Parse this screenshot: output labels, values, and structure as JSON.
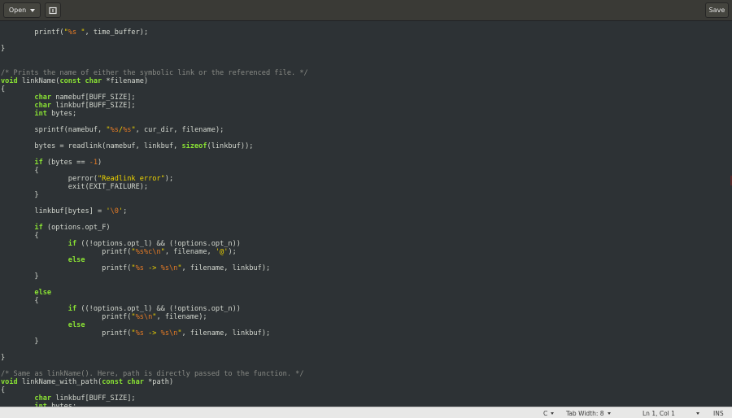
{
  "header": {
    "open_label": "Open",
    "new_tab_icon": "new-document-icon",
    "save_label": "Save"
  },
  "editor": {
    "language": "C",
    "lines": [
      [
        [
          "",
          "        printf("
        ],
        [
          "str",
          "\""
        ],
        [
          "esc",
          "%s"
        ],
        [
          "str",
          " \""
        ],
        [
          "",
          ", time_buffer);"
        ]
      ],
      [],
      [
        [
          "",
          "}"
        ]
      ],
      [],
      [],
      [
        [
          "cmt",
          "/* Prints the name of either the symbolic link or the referenced file. */"
        ]
      ],
      [
        [
          "kw",
          "void"
        ],
        [
          "",
          " linkName("
        ],
        [
          "kw",
          "const char"
        ],
        [
          "",
          " *filename)"
        ]
      ],
      [
        [
          "",
          "{"
        ]
      ],
      [
        [
          "",
          "        "
        ],
        [
          "kw",
          "char"
        ],
        [
          "",
          " namebuf[BUFF_SIZE];"
        ]
      ],
      [
        [
          "",
          "        "
        ],
        [
          "kw",
          "char"
        ],
        [
          "",
          " linkbuf[BUFF_SIZE];"
        ]
      ],
      [
        [
          "",
          "        "
        ],
        [
          "kw",
          "int"
        ],
        [
          "",
          " bytes;"
        ]
      ],
      [],
      [
        [
          "",
          "        sprintf(namebuf, "
        ],
        [
          "str",
          "\""
        ],
        [
          "esc",
          "%s"
        ],
        [
          "str",
          "/"
        ],
        [
          "esc",
          "%s"
        ],
        [
          "str",
          "\""
        ],
        [
          "",
          ", cur_dir, filename);"
        ]
      ],
      [],
      [
        [
          "",
          "        bytes = readlink(namebuf, linkbuf, "
        ],
        [
          "kw",
          "sizeof"
        ],
        [
          "",
          "(linkbuf));"
        ]
      ],
      [],
      [
        [
          "",
          "        "
        ],
        [
          "kw",
          "if"
        ],
        [
          "",
          " (bytes == "
        ],
        [
          "esc",
          "-1"
        ],
        [
          "",
          ")"
        ]
      ],
      [
        [
          "",
          "        {"
        ]
      ],
      [
        [
          "",
          "                perror("
        ],
        [
          "str",
          "\"Readlink error\""
        ],
        [
          "",
          ");"
        ]
      ],
      [
        [
          "",
          "                exit(EXIT_FAILURE);"
        ]
      ],
      [
        [
          "",
          "        }"
        ]
      ],
      [],
      [
        [
          "",
          "        linkbuf[bytes] = "
        ],
        [
          "str",
          "'"
        ],
        [
          "esc",
          "\\0"
        ],
        [
          "str",
          "'"
        ],
        [
          "",
          ";"
        ]
      ],
      [],
      [
        [
          "",
          "        "
        ],
        [
          "kw",
          "if"
        ],
        [
          "",
          " (options.opt_F)"
        ]
      ],
      [
        [
          "",
          "        {"
        ]
      ],
      [
        [
          "",
          "                "
        ],
        [
          "kw",
          "if"
        ],
        [
          "",
          " ((!options.opt_l) && (!options.opt_n))"
        ]
      ],
      [
        [
          "",
          "                        printf("
        ],
        [
          "str",
          "\""
        ],
        [
          "esc",
          "%s%c\\n"
        ],
        [
          "str",
          "\""
        ],
        [
          "",
          ", filename, "
        ],
        [
          "str",
          "'@'"
        ],
        [
          "",
          ");"
        ]
      ],
      [
        [
          "",
          "                "
        ],
        [
          "kw",
          "else"
        ]
      ],
      [
        [
          "",
          "                        printf("
        ],
        [
          "str",
          "\""
        ],
        [
          "esc",
          "%s"
        ],
        [
          "str",
          " -> "
        ],
        [
          "esc",
          "%s\\n"
        ],
        [
          "str",
          "\""
        ],
        [
          "",
          ", filename, linkbuf);"
        ]
      ],
      [
        [
          "",
          "        }"
        ]
      ],
      [],
      [
        [
          "",
          "        "
        ],
        [
          "kw",
          "else"
        ]
      ],
      [
        [
          "",
          "        {"
        ]
      ],
      [
        [
          "",
          "                "
        ],
        [
          "kw",
          "if"
        ],
        [
          "",
          " ((!options.opt_l) && (!options.opt_n))"
        ]
      ],
      [
        [
          "",
          "                        printf("
        ],
        [
          "str",
          "\""
        ],
        [
          "esc",
          "%s\\n"
        ],
        [
          "str",
          "\""
        ],
        [
          "",
          ", filename);"
        ]
      ],
      [
        [
          "",
          "                "
        ],
        [
          "kw",
          "else"
        ]
      ],
      [
        [
          "",
          "                        printf("
        ],
        [
          "str",
          "\""
        ],
        [
          "esc",
          "%s"
        ],
        [
          "str",
          " -> "
        ],
        [
          "esc",
          "%s\\n"
        ],
        [
          "str",
          "\""
        ],
        [
          "",
          ", filename, linkbuf);"
        ]
      ],
      [
        [
          "",
          "        }"
        ]
      ],
      [],
      [
        [
          "",
          "}"
        ]
      ],
      [],
      [
        [
          "cmt",
          "/* Same as linkName(). Here, path is directly passed to the function. */"
        ]
      ],
      [
        [
          "kw",
          "void"
        ],
        [
          "",
          " linkName_with_path("
        ],
        [
          "kw",
          "const char"
        ],
        [
          "",
          " *path)"
        ]
      ],
      [
        [
          "",
          "{"
        ]
      ],
      [
        [
          "",
          "        "
        ],
        [
          "kw",
          "char"
        ],
        [
          "",
          " linkbuf[BUFF_SIZE];"
        ]
      ],
      [
        [
          "",
          "        "
        ],
        [
          "kw",
          "int"
        ],
        [
          "",
          " bytes;"
        ]
      ]
    ]
  },
  "status": {
    "language": "C",
    "tab_width": "Tab Width: 8",
    "position": "Ln 1, Col 1",
    "mode": "INS"
  },
  "colors": {
    "background": "#2d3235",
    "keyword": "#8ae234",
    "string": "#edd400",
    "escape": "#e57b26",
    "comment": "#888a85"
  }
}
